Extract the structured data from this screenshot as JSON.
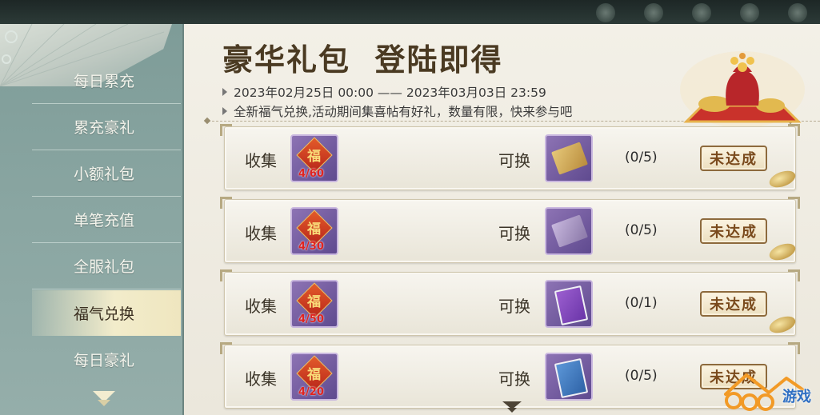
{
  "sidebar": {
    "items": [
      {
        "label": "每日累充",
        "active": false
      },
      {
        "label": "累充豪礼",
        "active": false
      },
      {
        "label": "小额礼包",
        "active": false
      },
      {
        "label": "单笔充值",
        "active": false
      },
      {
        "label": "全服礼包",
        "active": false
      },
      {
        "label": "福气兑换",
        "active": true
      },
      {
        "label": "每日豪礼",
        "active": false
      }
    ]
  },
  "header": {
    "title": "豪华礼包  登陆即得",
    "time_range": "2023年02月25日 00:00 —— 2023年03月03日 23:59",
    "description": "全新福气兑换,活动期间集喜帖有好礼，数量有限，快来参与吧"
  },
  "rows": [
    {
      "collect_label": "收集",
      "progress": "4/60",
      "exchange_label": "可换",
      "reward_icon": "gold-ticket-icon",
      "count": "(0/5)",
      "button": "未达成"
    },
    {
      "collect_label": "收集",
      "progress": "4/30",
      "exchange_label": "可换",
      "reward_icon": "purple-ticket-icon",
      "count": "(0/5)",
      "button": "未达成"
    },
    {
      "collect_label": "收集",
      "progress": "4/50",
      "exchange_label": "可换",
      "reward_icon": "violet-book-icon",
      "count": "(0/1)",
      "button": "未达成"
    },
    {
      "collect_label": "收集",
      "progress": "4/20",
      "exchange_label": "可换",
      "reward_icon": "blue-book-icon",
      "count": "(0/5)",
      "button": "未达成"
    }
  ],
  "fu_char": "福",
  "watermark": {
    "text": "游戏"
  },
  "colors": {
    "accent": "#8d6a3d",
    "progress_red": "#e0241f",
    "sidebar": "#8aa6a2"
  }
}
